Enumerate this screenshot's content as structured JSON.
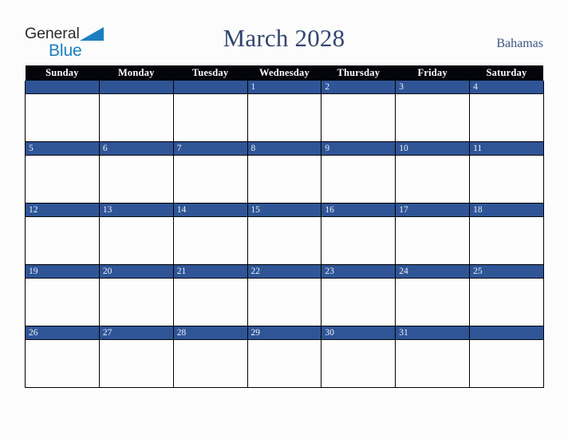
{
  "logo": {
    "word_one": "General",
    "word_two": "Blue",
    "triangle_icon": "triangle-icon",
    "brand_blue": "#1a7fc1",
    "brand_dark": "#2b2b2b"
  },
  "header": {
    "title": "March 2028",
    "month": "March",
    "year": "2028",
    "country": "Bahamas",
    "title_color": "#33466f",
    "country_color": "#3e5584"
  },
  "calendar": {
    "weekday_headers": [
      "Sunday",
      "Monday",
      "Tuesday",
      "Wednesday",
      "Thursday",
      "Friday",
      "Saturday"
    ],
    "header_bg": "#04050a",
    "header_text": "#ffffff",
    "date_bar_color": "#2f5597",
    "date_text_color": "#eef1f7",
    "cell_bg": "#fdfdfd",
    "border_color": "#000000",
    "weeks": [
      {
        "days": [
          "",
          "",
          "",
          "1",
          "2",
          "3",
          "4"
        ]
      },
      {
        "days": [
          "5",
          "6",
          "7",
          "8",
          "9",
          "10",
          "11"
        ]
      },
      {
        "days": [
          "12",
          "13",
          "14",
          "15",
          "16",
          "17",
          "18"
        ]
      },
      {
        "days": [
          "19",
          "20",
          "21",
          "22",
          "23",
          "24",
          "25"
        ]
      },
      {
        "days": [
          "26",
          "27",
          "28",
          "29",
          "30",
          "31",
          ""
        ]
      }
    ]
  },
  "page": {
    "background": "#fcfcfc"
  }
}
